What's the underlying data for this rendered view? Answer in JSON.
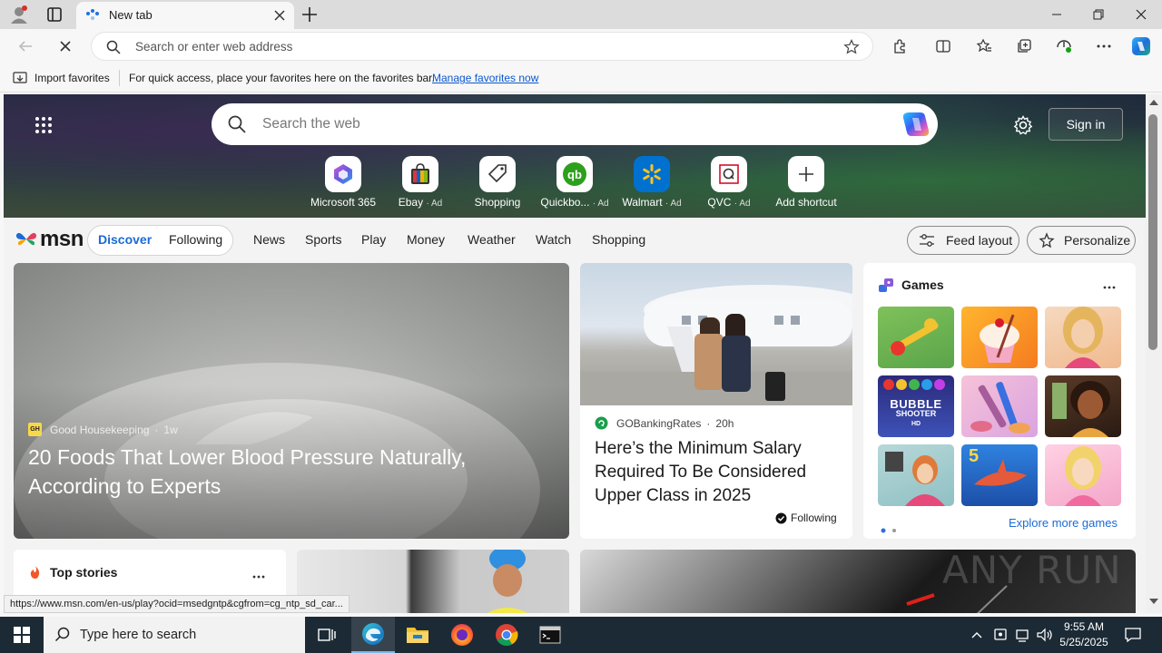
{
  "browser": {
    "tab_title": "New tab",
    "address_placeholder": "Search or enter web address",
    "favorites_bar": {
      "import_label": "Import favorites",
      "hint_text": "For quick access, place your favorites here on the favorites bar.",
      "manage_link": "Manage favorites now"
    },
    "status_url": "https://www.msn.com/en-us/play?ocid=msedgntp&cgfrom=cg_ntp_sd_car..."
  },
  "new_tab": {
    "search_placeholder": "Search the web",
    "sign_in_label": "Sign in",
    "shortcuts": [
      {
        "label": "Microsoft 365",
        "ad": ""
      },
      {
        "label": "Ebay",
        "ad": "· Ad"
      },
      {
        "label": "Shopping",
        "ad": ""
      },
      {
        "label": "Quickbo...",
        "ad": "· Ad"
      },
      {
        "label": "Walmart",
        "ad": "· Ad"
      },
      {
        "label": "QVC",
        "ad": "· Ad"
      },
      {
        "label": "Add shortcut",
        "ad": ""
      }
    ]
  },
  "msn": {
    "logo_text": "msn",
    "toggle": {
      "discover": "Discover",
      "following": "Following"
    },
    "nav_links": [
      "News",
      "Sports",
      "Play",
      "Money",
      "Weather",
      "Watch",
      "Shopping"
    ],
    "feed_layout_label": "Feed layout",
    "personalize_label": "Personalize"
  },
  "cards": {
    "main": {
      "source": "Good Housekeeping",
      "source_badge": "GH",
      "age": "1w",
      "title": "20 Foods That Lower Blood Pressure Naturally, According to Experts"
    },
    "second": {
      "source": "GOBankingRates",
      "age": "20h",
      "title": "Here’s the Minimum Salary Required To Be Considered Upper Class in 2025",
      "following_label": "Following"
    },
    "games": {
      "title": "Games",
      "explore_label": "Explore more games",
      "bubble_line1": "BUBBLE",
      "bubble_line2": "SHOOTER",
      "bubble_line3": "HD",
      "shark_number": "5"
    },
    "top_stories": {
      "title": "Top stories"
    }
  },
  "taskbar": {
    "search_placeholder": "Type here to search",
    "time": "9:55 AM",
    "date": "5/25/2025"
  },
  "watermark": "ANY RUN",
  "colors": {
    "accent": "#0b57d0",
    "taskbar": "#1c2a35",
    "msn_blue": "#1b6bd6"
  }
}
